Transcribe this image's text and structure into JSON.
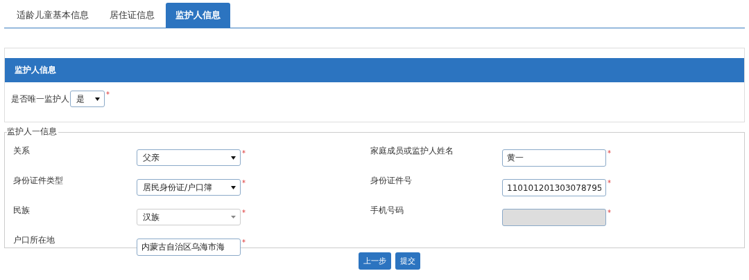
{
  "tabs": [
    {
      "label": "适龄儿童基本信息",
      "selected": false
    },
    {
      "label": "居住证信息",
      "selected": false
    },
    {
      "label": "监护人信息",
      "selected": true
    }
  ],
  "panel": {
    "title": "监护人信息",
    "only_guardian": {
      "label": "是否唯一监护人",
      "value": "是",
      "required_mark": "*"
    }
  },
  "guardian_one": {
    "legend": "监护人一信息",
    "fields": [
      {
        "label": "关系",
        "kind": "select",
        "value": "父亲",
        "required_mark": "*",
        "disabled": false
      },
      {
        "label": "家庭成员或监护人姓名",
        "kind": "input",
        "value": "黄一",
        "required_mark": "*",
        "disabled": false
      },
      {
        "label": "身份证件类型",
        "kind": "select",
        "value": "居民身份证/户口簿",
        "required_mark": "*",
        "disabled": false
      },
      {
        "label": "身份证件号",
        "kind": "input",
        "value": "110101201303078795",
        "required_mark": "*",
        "disabled": false
      },
      {
        "label": "民族",
        "kind": "combo",
        "value": "汉族",
        "required_mark": "*",
        "disabled": false
      },
      {
        "label": "手机号码",
        "kind": "input",
        "required_mark": "*",
        "disabled": true
      },
      {
        "label": "户口所在地",
        "kind": "input",
        "value": "内蒙古自治区乌海市海",
        "required_mark": "*",
        "disabled": false
      }
    ]
  },
  "buttons": [
    {
      "label": "上一步"
    },
    {
      "label": "提交"
    }
  ]
}
